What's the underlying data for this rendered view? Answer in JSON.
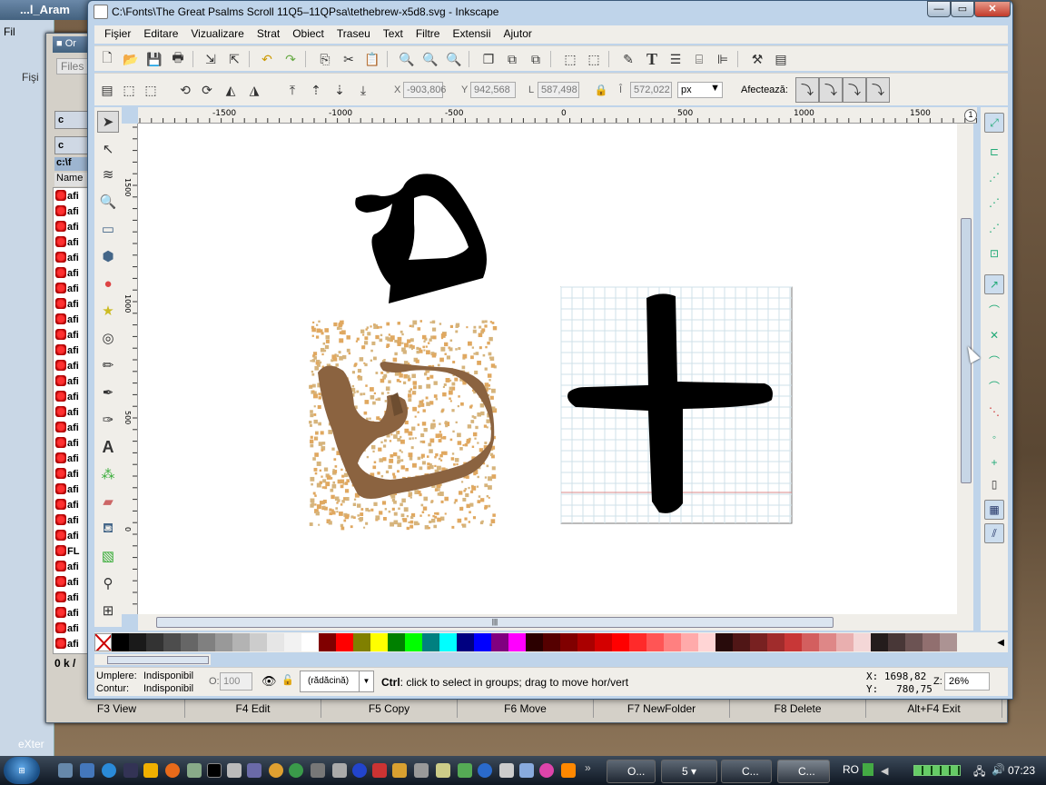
{
  "behind": {
    "title": "...l_Aram",
    "side_labels": [
      "Fil",
      "Fişi",
      "Files",
      "c",
      "c",
      "c:\\f",
      "Name",
      "0 k /",
      "eXter"
    ]
  },
  "tc": {
    "files": [
      "afi",
      "afi",
      "afi",
      "afi",
      "afi",
      "afi",
      "afi",
      "afi",
      "afi",
      "afi",
      "afi",
      "afi",
      "afi",
      "afi",
      "afi",
      "afi",
      "afi",
      "afi",
      "afi",
      "afi",
      "afi",
      "afi",
      "afi",
      "FL",
      "afi",
      "afi",
      "afi",
      "afi",
      "afi",
      "afi"
    ],
    "fkeys": [
      "F3 View",
      "F4 Edit",
      "F5 Copy",
      "F6 Move",
      "F7 NewFolder",
      "F8 Delete",
      "Alt+F4 Exit"
    ]
  },
  "inkscape": {
    "title": "C:\\Fonts\\The Great Psalms Scroll 11Q5–11QPsa\\tethebrew-x5d8.svg - Inkscape",
    "menu": [
      "Fişier",
      "Editare",
      "Vizualizare",
      "Strat",
      "Obiect",
      "Traseu",
      "Text",
      "Filtre",
      "Extensii",
      "Ajutor"
    ],
    "controls": {
      "x_label": "X",
      "x_value": "-903,806",
      "y_label": "Y",
      "y_value": "942,568",
      "w_label": "L",
      "w_value": "587,498",
      "h_label": "Î",
      "h_value": "572,022",
      "unit": "px",
      "affect_label": "Afectează:"
    },
    "ruler_top": [
      "-1500",
      "-1000",
      "-500",
      "0",
      "500",
      "1000",
      "1500"
    ],
    "ruler_left": [
      "1500",
      "1000",
      "500",
      "0"
    ],
    "status": {
      "fill_label": "Umplere:",
      "fill_value": "Indisponibil",
      "stroke_label": "Contur:",
      "stroke_value": "Indisponibil",
      "opacity_label": "O:",
      "opacity_value": "100",
      "layer": "(rădăcină)",
      "message_bold": "Ctrl",
      "message": ": click to select in groups; drag to move hor/vert",
      "x_coord": "X: 1698,82",
      "y_coord": "Y:   780,75",
      "zoom_label": "Z:",
      "zoom_value": "26%"
    },
    "palette": [
      "#000000",
      "#1a1a1a",
      "#333333",
      "#4d4d4d",
      "#666666",
      "#808080",
      "#999999",
      "#b3b3b3",
      "#cccccc",
      "#e6e6e6",
      "#f2f2f2",
      "#ffffff",
      "#800000",
      "#ff0000",
      "#808000",
      "#ffff00",
      "#008000",
      "#00ff00",
      "#008080",
      "#00ffff",
      "#000080",
      "#0000ff",
      "#800080",
      "#ff00ff",
      "#2b0000",
      "#550000",
      "#800000",
      "#aa0000",
      "#d40000",
      "#ff0000",
      "#ff2a2a",
      "#ff5555",
      "#ff8080",
      "#ffaaaa",
      "#ffd5d5",
      "#280b0b",
      "#501616",
      "#782121",
      "#a02c2c",
      "#c83737",
      "#d35f5f",
      "#de8787",
      "#e9afaf",
      "#f4d7d7",
      "#241c1c",
      "#483737",
      "#6c5353",
      "#916f6f",
      "#ac9393"
    ]
  },
  "taskbar": {
    "tasks": [
      "O...",
      "5",
      "C...",
      "C..."
    ],
    "lang": "RO",
    "time": "07:23"
  }
}
